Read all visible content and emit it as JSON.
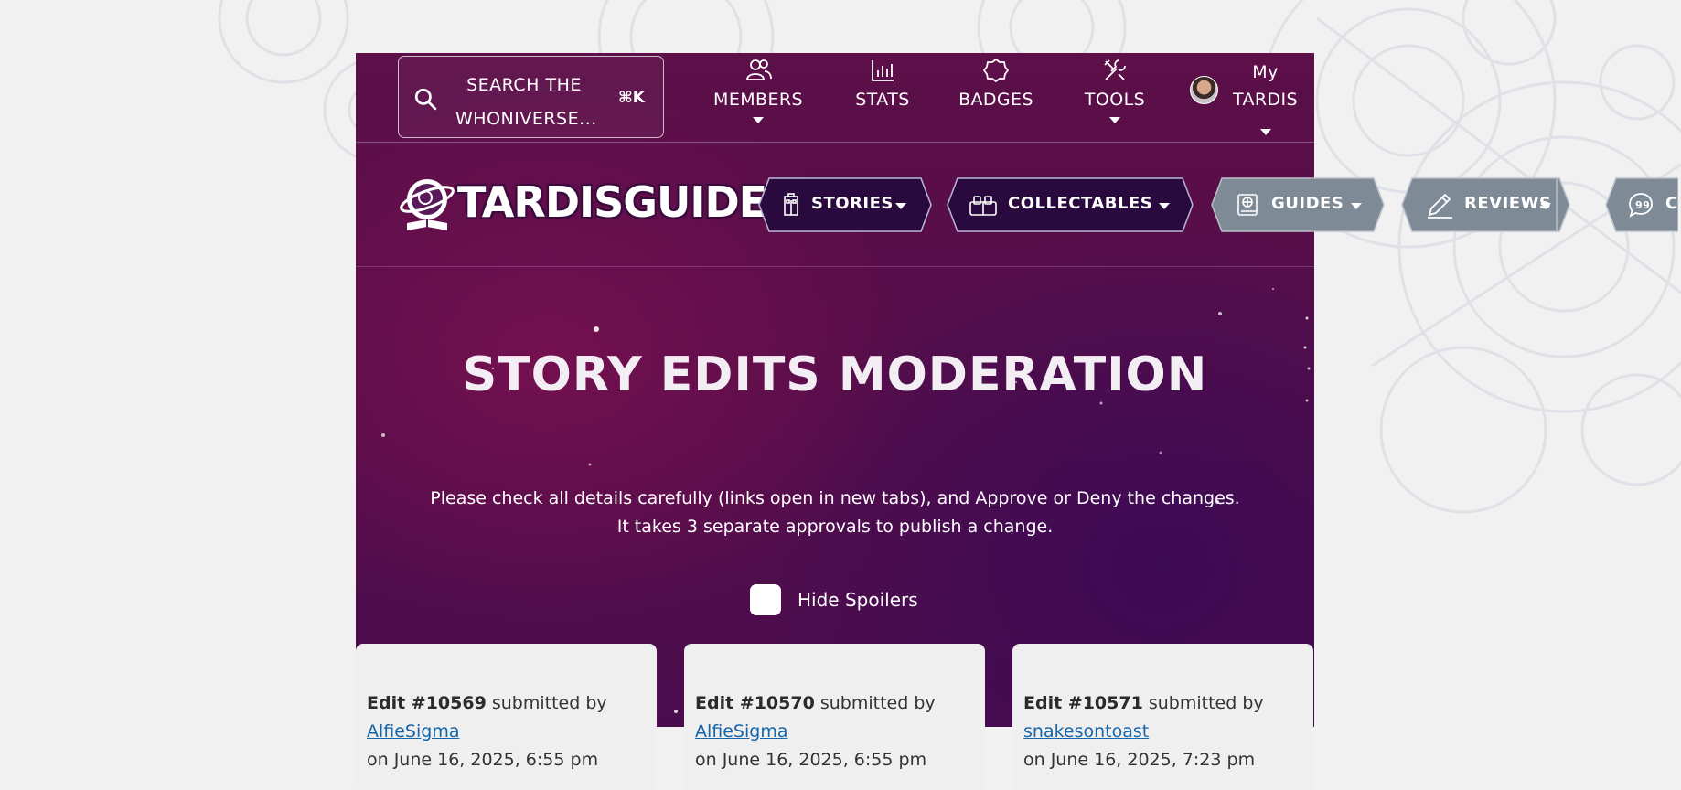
{
  "search": {
    "label": "SEARCH THE\nWHONIVERSE...",
    "shortcut": "⌘K"
  },
  "nav": [
    {
      "label": "MEMBERS",
      "icon": "members-icon",
      "has_menu": true
    },
    {
      "label": "STATS",
      "icon": "stats-icon",
      "has_menu": false
    },
    {
      "label": "BADGES",
      "icon": "badge-icon",
      "has_menu": false
    },
    {
      "label": "TOOLS",
      "icon": "tools-icon",
      "has_menu": true
    }
  ],
  "account": {
    "label": "My\nTARDIS"
  },
  "logo": {
    "text": "TARDISGUIDE"
  },
  "sections": [
    {
      "label": "STORIES",
      "icon": "tardis-icon"
    },
    {
      "label": "COLLECTABLES",
      "icon": "collectables-icon"
    },
    {
      "label": "GUIDES",
      "icon": "guide-book-icon"
    },
    {
      "label": "REVIEWS",
      "icon": "pencil-icon"
    },
    {
      "label": "C",
      "icon": "quote-bubble-icon"
    }
  ],
  "hero": {
    "title": "STORY EDITS MODERATION",
    "subtitle_line1": "Please check all details carefully (links open in new tabs), and Approve or Deny the changes.",
    "subtitle_line2": "It takes 3 separate approvals to publish a change.",
    "spoiler_label": "Hide Spoilers"
  },
  "cards": [
    {
      "edit": "Edit #10569",
      "submitted_by": "submitted by",
      "user": "AlfieSigma",
      "date": "on June 16, 2025, 6:55 pm"
    },
    {
      "edit": "Edit #10570",
      "submitted_by": "submitted by",
      "user": "AlfieSigma",
      "date": "on June 16, 2025, 6:55 pm"
    },
    {
      "edit": "Edit #10571",
      "submitted_by": "submitted by",
      "user": "snakesontoast",
      "date": "on June 16, 2025, 7:23 pm"
    }
  ],
  "colors": {
    "page_bg": "#f1f1f2",
    "purple_dark": "#3d0a55",
    "magenta": "#74104f",
    "button_active_bg": "#2a0a3e",
    "button_inactive_bg": "#7f8a97",
    "link": "#1565a8"
  }
}
